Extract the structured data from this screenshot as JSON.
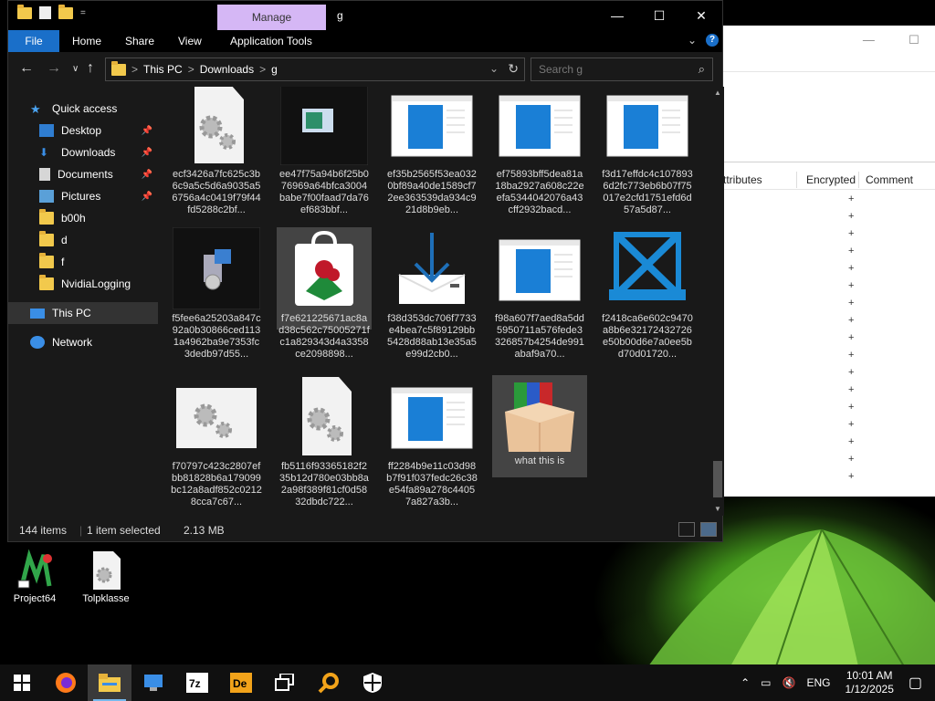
{
  "explorer": {
    "quick_access_sep": "=",
    "manage_tab": "Manage",
    "title": "g",
    "window_controls": {
      "minimize": "—",
      "maximize": "☐",
      "close": "✕"
    },
    "ribbon_tabs": [
      "File",
      "Home",
      "Share",
      "View",
      "Application Tools"
    ],
    "ribbon_expand": "⌄",
    "help": "?",
    "address": {
      "crumbs": [
        "This PC",
        "Downloads",
        "g"
      ],
      "separator": ">"
    },
    "search_placeholder": "Search g",
    "nav": {
      "quick_access": "Quick access",
      "items": [
        {
          "label": "Desktop",
          "pinned": true
        },
        {
          "label": "Downloads",
          "pinned": true
        },
        {
          "label": "Documents",
          "pinned": true
        },
        {
          "label": "Pictures",
          "pinned": true
        },
        {
          "label": "b00h",
          "pinned": false
        },
        {
          "label": "d",
          "pinned": false
        },
        {
          "label": "f",
          "pinned": false
        },
        {
          "label": "NvidiaLogging",
          "pinned": false
        }
      ],
      "this_pc": "This PC",
      "network": "Network"
    },
    "files": [
      {
        "name": "ecf3426a7fc625c3b6c9a5c5d6a9035a56756a4c0419f79f44fd5288c2bf...",
        "icon": "gear-doc-icon"
      },
      {
        "name": "ee47f75a94b6f25b076969a64bfca3004babe7f00faad7da76ef683bbf...",
        "icon": "app-window-icon"
      },
      {
        "name": "ef35b2565f53ea0320bf89a40de1589cf72ee363539da934c921d8b9eb...",
        "icon": "blue-window-icon"
      },
      {
        "name": "ef75893bff5dea81a18ba2927a608c22eefa5344042076a43cff2932bacd...",
        "icon": "blue-window-icon"
      },
      {
        "name": "f3d17effdc4c1078936d2fc773eb6b07f75017e2cfd1751efd6d57a5d87...",
        "icon": "blue-window-icon"
      },
      {
        "name": "f5fee6a25203a847c92a0b30866ced1131a4962ba9e7353fc3dedb97d55...",
        "icon": "installer-icon"
      },
      {
        "name": "f7e621225671ac8ad38c562c75005271fc1a829343d4a3358ce2098898...",
        "icon": "bag-icon"
      },
      {
        "name": "f38d353dc706f7733e4bea7c5f89129bb5428d88ab13e35a5e99d2cb0...",
        "icon": "download-tray-icon"
      },
      {
        "name": "f98a607f7aed8a5dd5950711a576fede3326857b4254de991abaf9a70...",
        "icon": "blue-window-icon"
      },
      {
        "name": "f2418ca6e602c9470a8b6e32172432726e50b00d6e7a0ee5bd70d01720...",
        "icon": "windows-x-icon"
      },
      {
        "name": "f70797c423c2807efbb81828b6a179099bc12a8adf852c02128cca7c67...",
        "icon": "gear-wide-icon"
      },
      {
        "name": "fb5116f93365182f235b12d780e03bb8a2a98f389f81cf0d5832dbdc722...",
        "icon": "gear-doc-icon"
      },
      {
        "name": "ff2284b9e11c03d98b7f91f037fedc26c38e54fa89a278c44057a827a3b...",
        "icon": "blue-window-icon"
      },
      {
        "name": "what this is",
        "icon": "library-box-icon"
      }
    ],
    "selected_file_index": 6,
    "hovered_file_index": 13,
    "status": {
      "count": "144 items",
      "selection": "1 item selected",
      "size": "2.13 MB"
    }
  },
  "bg_window": {
    "window_controls": {
      "minimize": "—",
      "maximize": "☐"
    },
    "columns": [
      "ttributes",
      "Encrypted",
      "Comment"
    ],
    "plus_marks": [
      "+",
      "+",
      "+",
      "+",
      "+",
      "+",
      "+",
      "+",
      "+",
      "+",
      "+",
      "+",
      "+",
      "+",
      "+",
      "+",
      "+"
    ]
  },
  "desktop_icons": [
    {
      "label": "Project64",
      "icon": "project64-icon"
    },
    {
      "label": "Tolpklasse",
      "icon": "gear-doc-icon"
    }
  ],
  "taskbar": {
    "apps": [
      "start-icon",
      "firefox-icon",
      "file-explorer-icon",
      "network-computer-icon",
      "7zip-icon",
      "dolphin-icon",
      "task-view-icon",
      "search-tool-icon",
      "security-icon"
    ],
    "active_index": 2,
    "tray": {
      "language": "ENG",
      "time": "10:01 AM",
      "date": "1/12/2025"
    }
  },
  "colors": {
    "accent": "#1a6fc9",
    "manage_tab": "#d5b7f5",
    "folder": "#f2c94c",
    "selection": "#444444"
  }
}
